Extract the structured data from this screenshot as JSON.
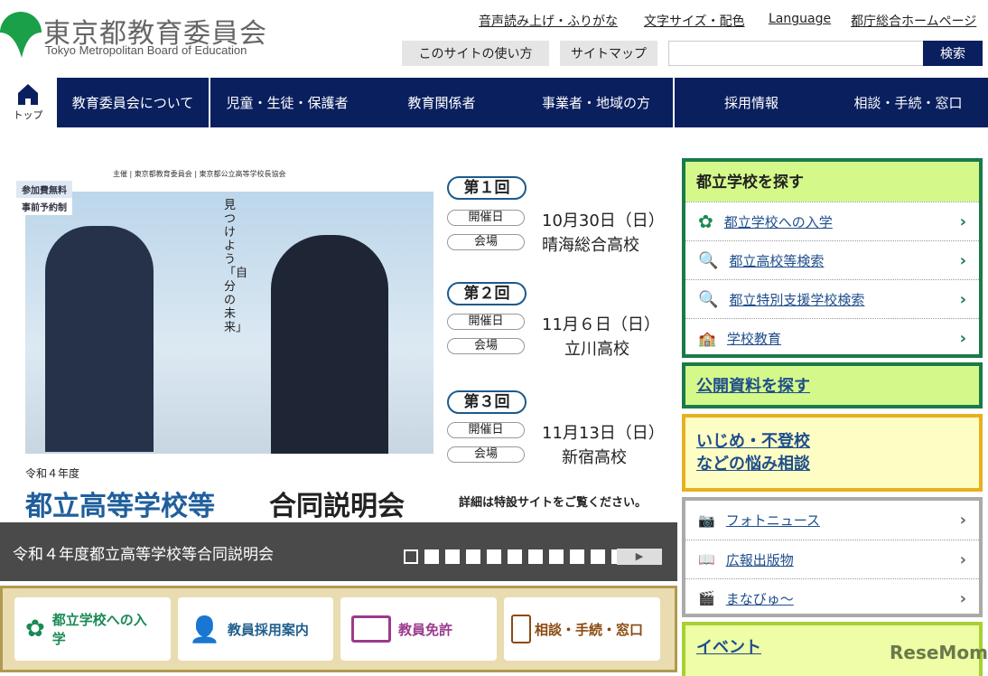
{
  "header": {
    "logo_jp": "東京都教育委員会",
    "logo_en": "Tokyo Metropolitan Board of Education",
    "links": [
      "音声読み上げ・ふりがな",
      "文字サイズ・配色",
      "Language",
      "都庁総合ホームページ"
    ],
    "buttons": [
      "このサイトの使い方",
      "サイトマップ"
    ],
    "search_value": "",
    "search_button": "検索"
  },
  "nav": {
    "home": "トップ",
    "items": [
      "教育委員会について",
      "児童・生徒・保護者",
      "教育関係者",
      "事業者・地域の方",
      "採用情報",
      "相談・手続・窓口"
    ]
  },
  "banner": {
    "sponsors": "主催 | 東京都教育委員会 | 東京都公立高等学校長協会",
    "tags": [
      "参加費無料",
      "事前予約制"
    ],
    "catch": "見つけよう「自分の未来」",
    "year": "令和４年度",
    "title_a": "都立高等学校等",
    "title_b": "合同説明会",
    "note": "詳細は特設サイトをご覧ください。",
    "date_label": "開催日",
    "venue_label": "会場",
    "sessions": [
      {
        "round": "第１回",
        "date": "10月30日（日）",
        "venue": "晴海総合高校"
      },
      {
        "round": "第２回",
        "date": "11月６日（日）",
        "venue": "立川高校"
      },
      {
        "round": "第３回",
        "date": "11月13日（日）",
        "venue": "新宿高校"
      }
    ]
  },
  "slider": {
    "caption": "令和４年度都立高等学校等合同説明会",
    "slide_count": 11,
    "current": 1
  },
  "quick": [
    {
      "label": "都立学校への入学",
      "color": "#1a8a55"
    },
    {
      "label": "教員採用案内",
      "color": "#1f5f8c"
    },
    {
      "label": "教員免許",
      "color": "#9b3a8c"
    },
    {
      "label": "相談・手続・窓口",
      "color": "#8a4a10"
    }
  ],
  "side": {
    "find_school": {
      "title": "都立学校を探す",
      "items": [
        "都立学校への入学",
        "都立高校等検索",
        "都立特別支援学校検索",
        "学校教育"
      ]
    },
    "public_docs": "公開資料を探す",
    "bullying_1": "いじめ・不登校",
    "bullying_2": "などの悩み相談",
    "media": [
      "フォトニュース",
      "広報出版物",
      "まなびゅ～"
    ],
    "event": "イベント"
  },
  "watermark": "ReseMom"
}
